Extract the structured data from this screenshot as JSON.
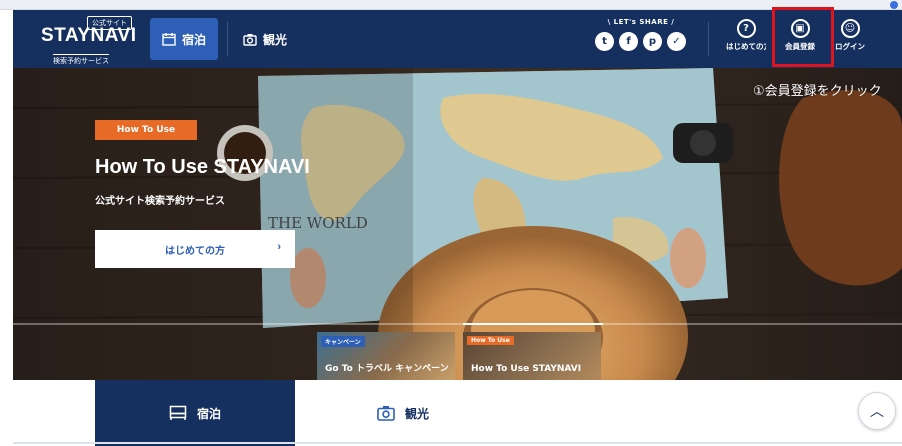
{
  "header": {
    "logo_official": "公式サイト",
    "logo_brand": "STAYNAVI",
    "logo_sub": "検索予約サービス",
    "nav_stay": "宿泊",
    "nav_sightseeing": "観光",
    "share_label": "\\ LET's SHARE /",
    "share_icons": [
      "twitter-icon",
      "facebook-icon",
      "pinterest-icon",
      "pocket-icon"
    ],
    "first_time_label": "はじめての方",
    "register_label": "会員登録",
    "login_label": "ログイン"
  },
  "annotation": "①会員登録をクリック",
  "hero": {
    "badge": "How To Use",
    "title": "How To Use STAYNAVI",
    "subtitle": "公式サイト検索予約サービス",
    "button_label": "はじめての方",
    "map_text": "THE WORLD",
    "thumbs": [
      {
        "tag": "キャンペーン",
        "caption": "Go To トラベル キャンペーン",
        "tag_color": "#2d5fb7"
      },
      {
        "tag": "How To Use",
        "caption": "How To Use STAYNAVI",
        "tag_color": "#e86a27"
      }
    ]
  },
  "bottom_tabs": {
    "stay": "宿泊",
    "sightseeing": "観光"
  },
  "colors": {
    "navy": "#15305f",
    "accent_blue": "#2d5fb7",
    "orange": "#e86a27",
    "highlight_red": "#e0141e"
  }
}
